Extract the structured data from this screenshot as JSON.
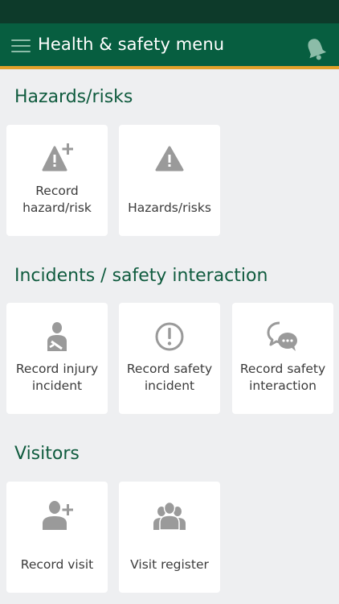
{
  "header": {
    "title": "Health & safety menu"
  },
  "sections": {
    "hazards": {
      "title": "Hazards/risks",
      "tiles": [
        {
          "label_line1": "Record",
          "label_line2": "hazard/risk",
          "icon": "warning-plus-icon"
        },
        {
          "label": "Hazards/risks",
          "icon": "warning-icon"
        }
      ]
    },
    "incidents": {
      "title": "Incidents / safety interaction",
      "tiles": [
        {
          "label_line1": "Record injury",
          "label_line2": "incident",
          "icon": "injured-person-icon"
        },
        {
          "label_line1": "Record safety",
          "label_line2": "incident",
          "icon": "exclamation-circle-icon"
        },
        {
          "label_line1": "Record safety",
          "label_line2": "interaction",
          "icon": "chat-bubbles-icon"
        }
      ]
    },
    "visitors": {
      "title": "Visitors",
      "tiles": [
        {
          "label": "Record visit",
          "icon": "add-person-icon"
        },
        {
          "label": "Visit register",
          "icon": "group-icon"
        }
      ]
    }
  },
  "colors": {
    "status_bar": "#0d3a2a",
    "app_bar": "#075e40",
    "accent": "#e3a12b",
    "section_title": "#0f5b3e",
    "icon_gray": "#9a9a9a",
    "background": "#eeeff1"
  }
}
